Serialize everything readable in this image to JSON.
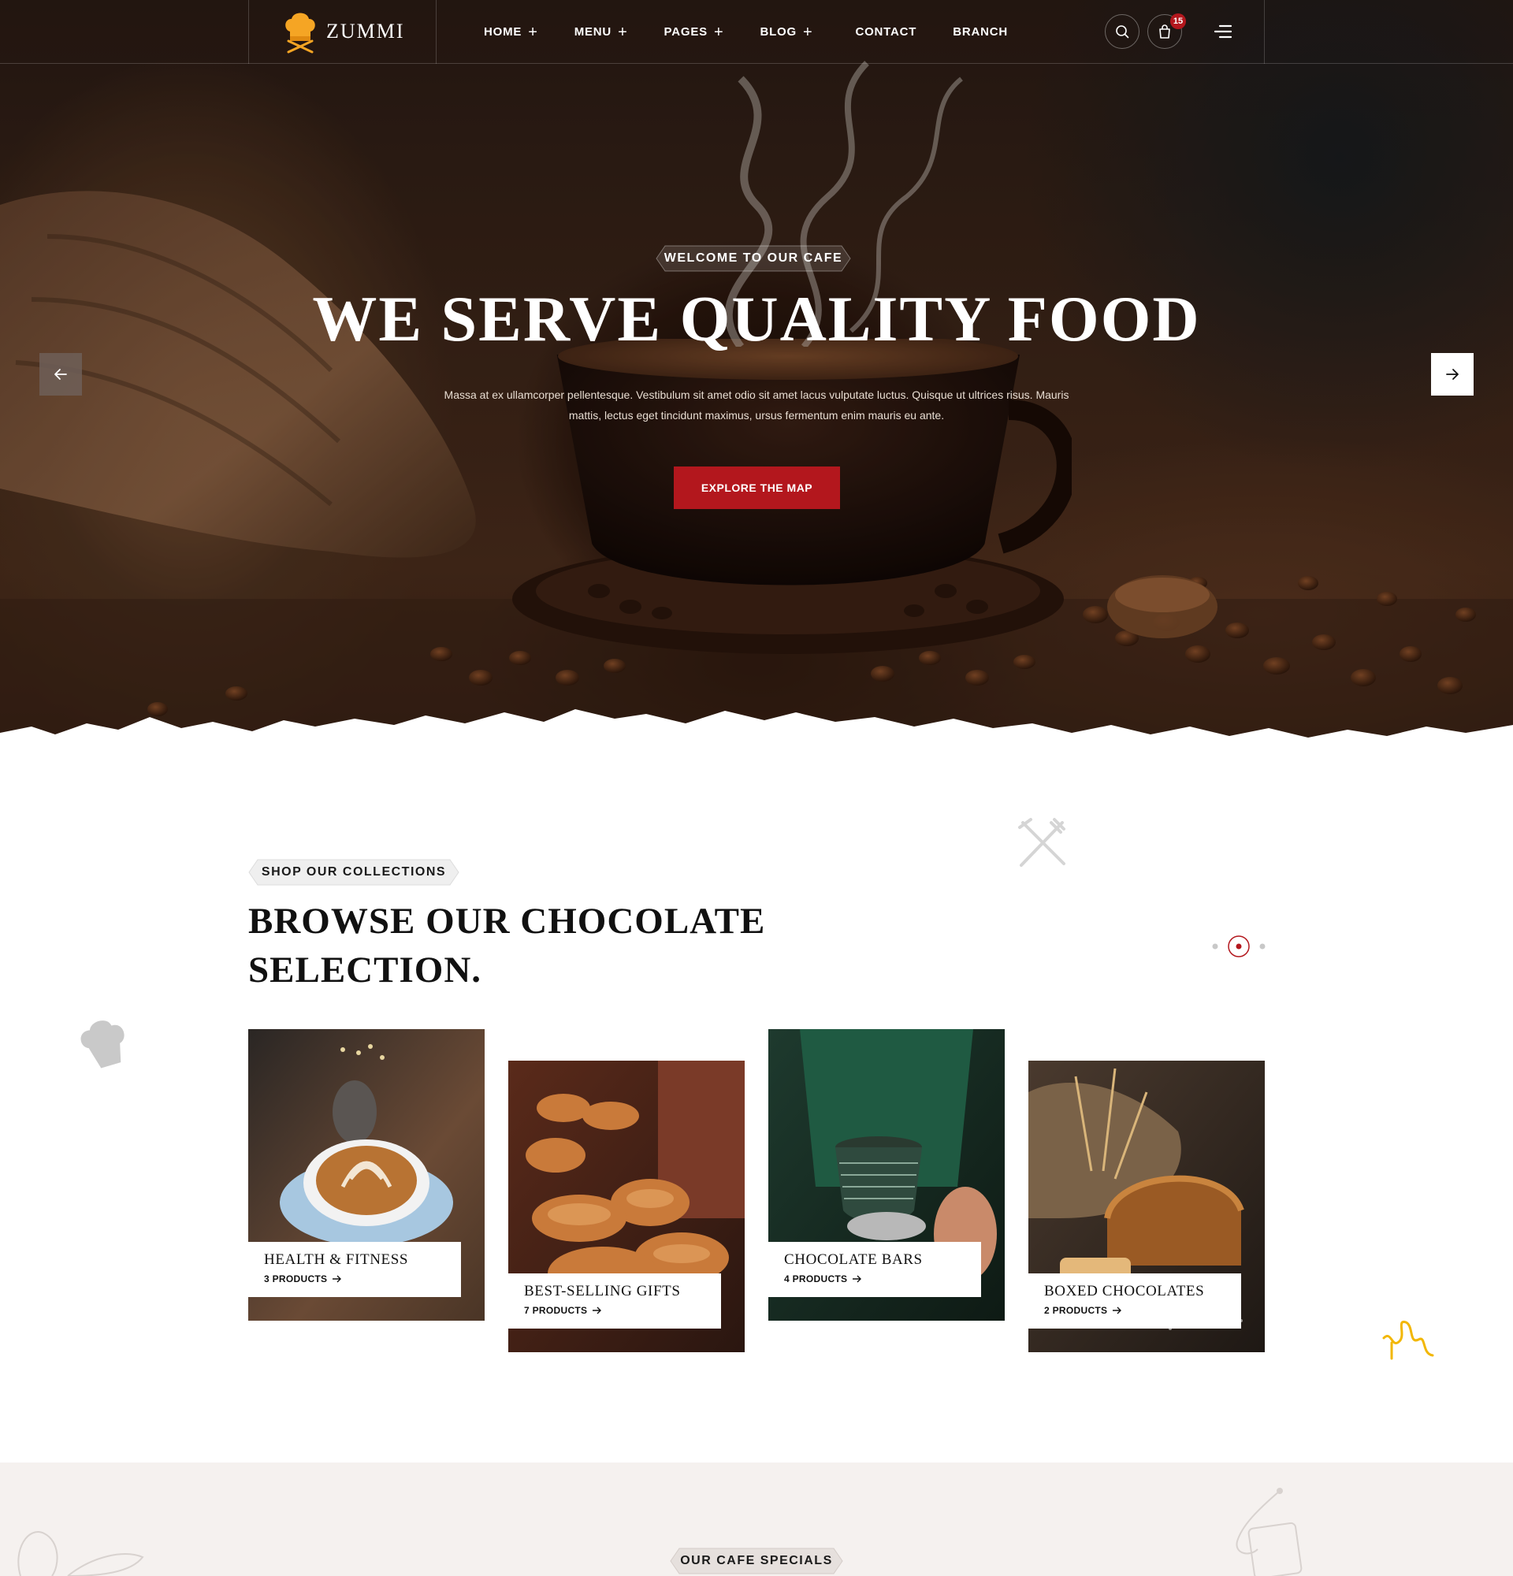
{
  "brand": {
    "name": "ZUMMI",
    "accent": "#b3171d",
    "logo_color": "#f5a524"
  },
  "nav": {
    "items": [
      {
        "label": "HOME",
        "has_submenu": true
      },
      {
        "label": "MENU",
        "has_submenu": true
      },
      {
        "label": "PAGES",
        "has_submenu": true
      },
      {
        "label": "BLOG",
        "has_submenu": true
      },
      {
        "label": "CONTACT",
        "has_submenu": false
      },
      {
        "label": "BRANCH",
        "has_submenu": false
      }
    ],
    "cart_count": "15",
    "icons": [
      "search-icon",
      "shopping-bag-icon",
      "menu-icon"
    ]
  },
  "hero": {
    "tag": "WELCOME TO OUR CAFE",
    "title": "WE SERVE QUALITY FOOD",
    "description_line1": "Massa at ex ullamcorper pellentesque. Vestibulum sit amet odio sit amet lacus vulputate luctus. Quisque ut ultrices risus. Mauris",
    "description_line2": "mattis, lectus eget tincidunt maximus, ursus fermentum enim mauris eu ante.",
    "button": "EXPLORE THE MAP"
  },
  "collections": {
    "tag": "SHOP OUR COLLECTIONS",
    "title": "BROWSE OUR CHOCOLATE SELECTION.",
    "cards": [
      {
        "title": "HEALTH & FITNESS",
        "count": "3 PRODUCTS"
      },
      {
        "title": "BEST-SELLING GIFTS",
        "count": "7 PRODUCTS"
      },
      {
        "title": "CHOCOLATE BARS",
        "count": "4 PRODUCTS"
      },
      {
        "title": "BOXED CHOCOLATES",
        "count": "2 PRODUCTS"
      }
    ]
  },
  "specials": {
    "tag": "OUR CAFE SPECIALS"
  }
}
